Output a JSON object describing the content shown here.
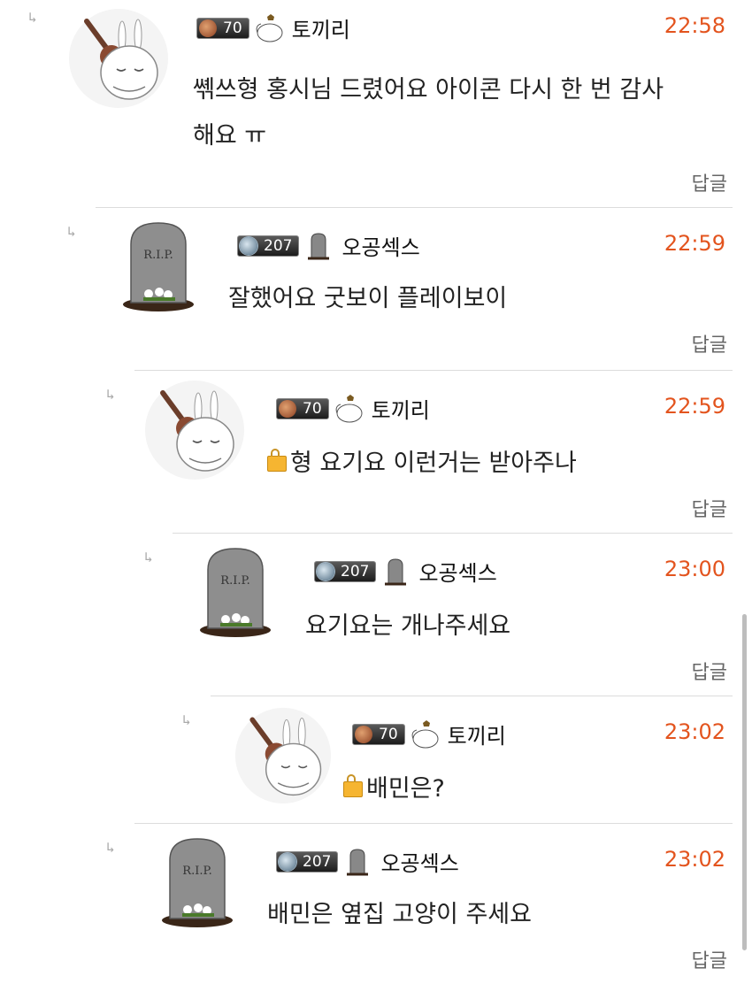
{
  "comments": [
    {
      "nickname": "토끼리",
      "level": "70",
      "time": "22:58",
      "text": "쎾쓰형 홍시님 드렸어요 아이콘 다시 한 번 감사\n해요 ㅠ",
      "locked": false,
      "avatar": "rabbit-avatar"
    },
    {
      "nickname": "오공섹스",
      "level": "207",
      "time": "22:59",
      "text": "잘했어요 굿보이 플레이보이",
      "locked": false,
      "avatar": "tombstone-avatar"
    },
    {
      "nickname": "토끼리",
      "level": "70",
      "time": "22:59",
      "text": "형 요기요 이런거는 받아주나",
      "locked": true,
      "avatar": "rabbit-avatar"
    },
    {
      "nickname": "오공섹스",
      "level": "207",
      "time": "23:00",
      "text": "요기요는 개나주세요",
      "locked": false,
      "avatar": "tombstone-avatar"
    },
    {
      "nickname": "토끼리",
      "level": "70",
      "time": "23:02",
      "text": "배민은?",
      "locked": true,
      "avatar": "rabbit-avatar"
    },
    {
      "nickname": "오공섹스",
      "level": "207",
      "time": "23:02",
      "text": "배민은 옆집 고양이 주세요",
      "locked": false,
      "avatar": "tombstone-avatar"
    }
  ],
  "reply_label": "답글",
  "reply_arrow": "↳",
  "tombstone_text": "R.I.P.",
  "colors": {
    "time": "#e3541e",
    "divider": "#dcdcdc",
    "accent_lock": "#f6b531"
  }
}
